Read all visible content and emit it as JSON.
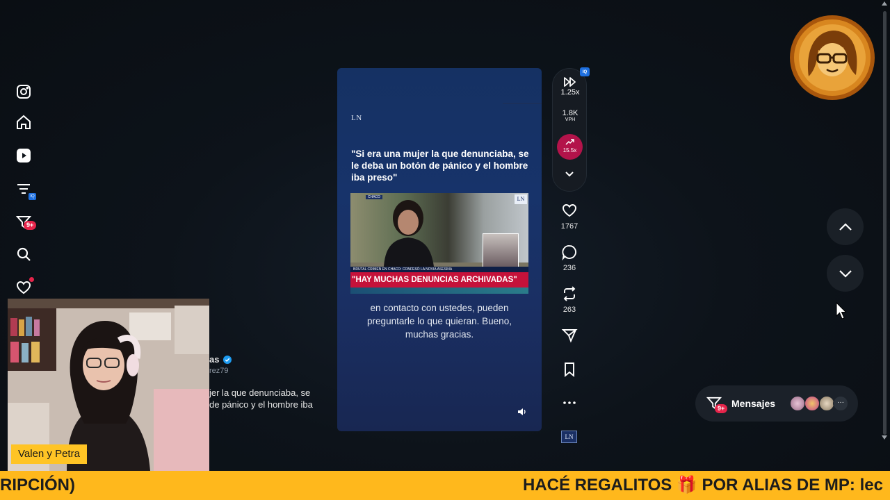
{
  "sidebar": {
    "items": [
      {
        "name": "instagram"
      },
      {
        "name": "home"
      },
      {
        "name": "youtube"
      },
      {
        "name": "filter"
      },
      {
        "name": "messages",
        "badge": "9+"
      },
      {
        "name": "search"
      },
      {
        "name": "notifications"
      }
    ],
    "mini_badge": "IQ"
  },
  "video": {
    "source_logo": "LN",
    "quote": "\"Si era una mujer la que denunciaba, se le deba un botón de pánico y el hombre iba preso\"",
    "clip_tag": "CHACO",
    "clip_caption": "BRUTAL CRIMEN EN CHACO: CONFESÓ LA NOVIA ASESINA",
    "clip_banner": "\"HAY MUCHAS DENUNCIAS ARCHIVADAS\"",
    "clip_logo": "LN",
    "subtitles": "en contacto con ustedes, pueden preguntarle lo que quieran. Bueno, muchas gracias."
  },
  "speed_panel": {
    "badge": "IQ",
    "speed": "1.25x",
    "vph_value": "1.8K",
    "vph_label": "VPH",
    "trend": "15.5x"
  },
  "actions": {
    "likes": "1767",
    "comments": "236",
    "reposts": "263"
  },
  "channel_logo": "LN",
  "post": {
    "author_fragment": "as",
    "handle_fragment": "rez79",
    "text_line1": "jer la que denunciaba, se",
    "text_line2": "de pánico y el hombre iba"
  },
  "messages": {
    "label": "Mensajes",
    "badge": "9+"
  },
  "webcam": {
    "name": "Valen y Petra"
  },
  "ticker": {
    "left_text": "RIPCIÓN)",
    "right_text": "HACÉ REGALITOS 🎁 POR ALIAS DE MP: lec"
  },
  "colors": {
    "accent_red": "#e5244a",
    "trend_pink": "#b3134a",
    "ticker_yellow": "#ffb81c",
    "verified_blue": "#1d9bf0"
  }
}
